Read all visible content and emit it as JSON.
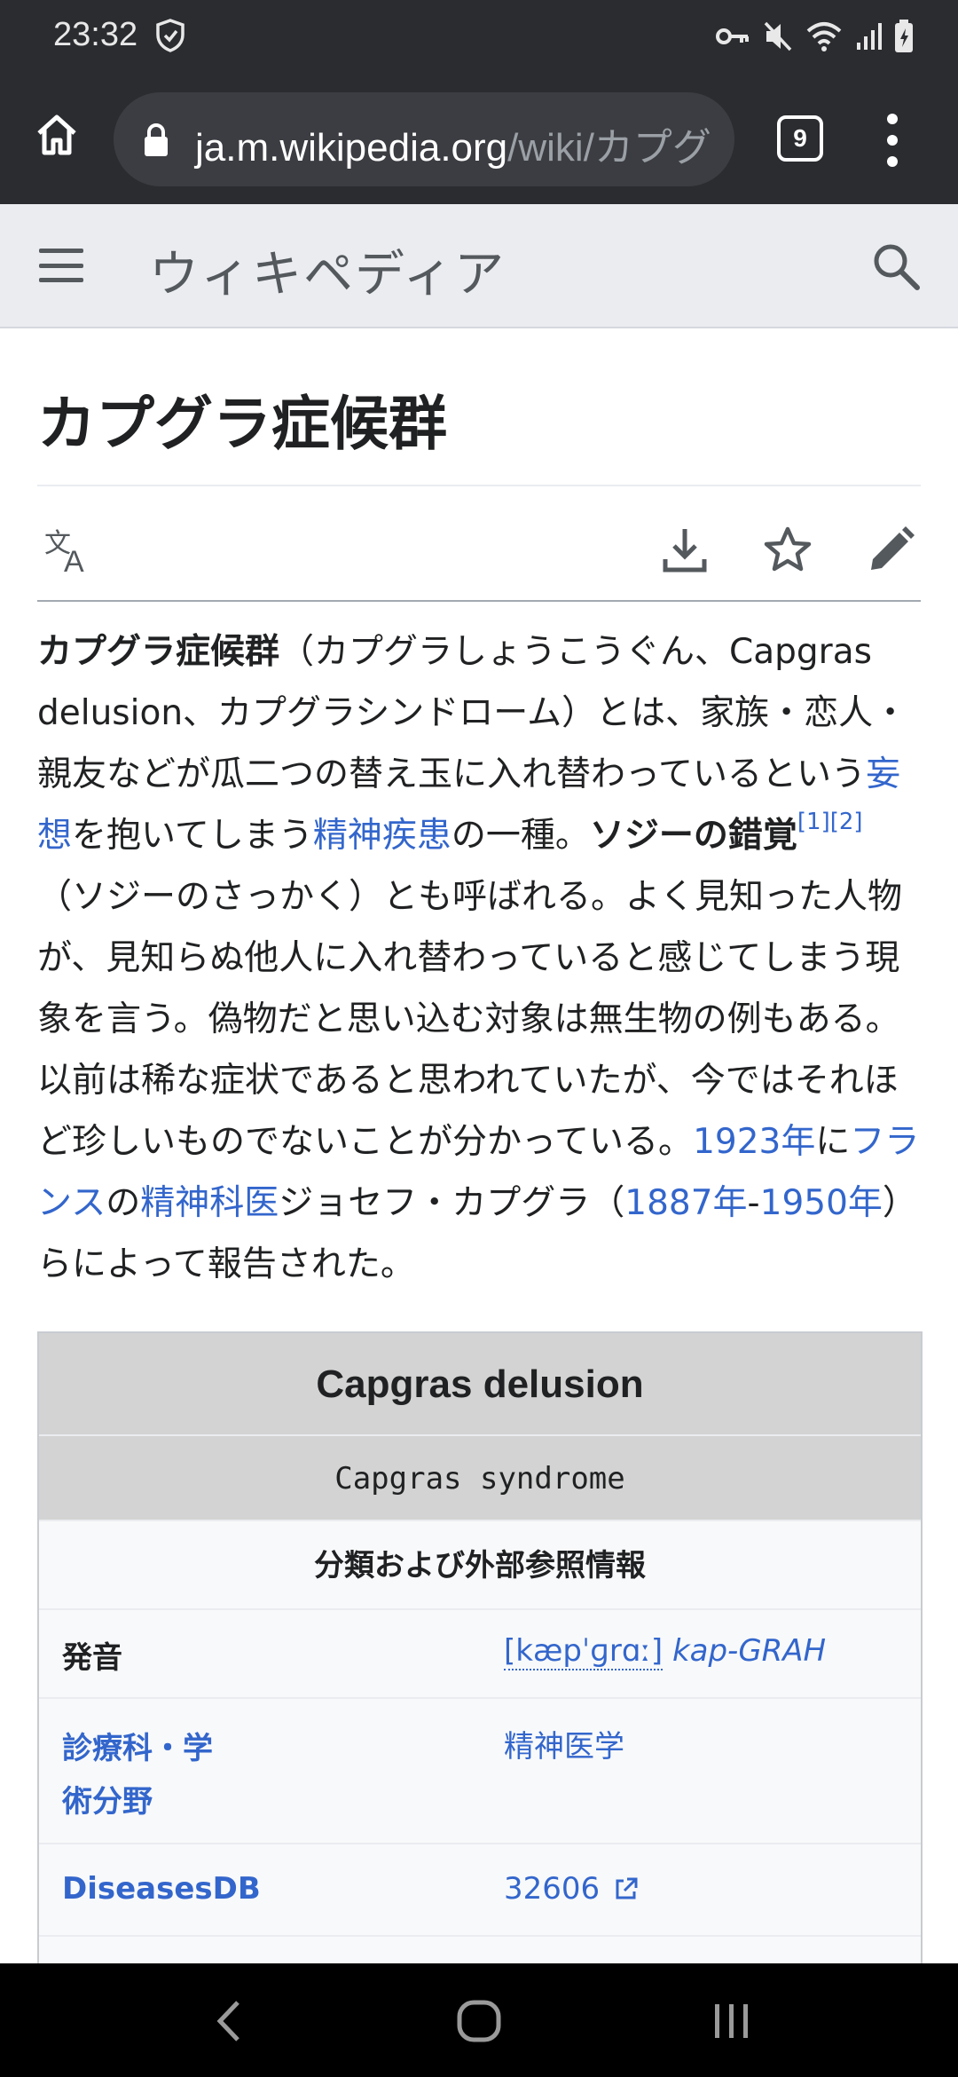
{
  "status_bar": {
    "time": "23:32"
  },
  "browser": {
    "url_domain": "ja.m.wikipedia.org",
    "url_path": "/wiki/カプグ",
    "tab_count": "9"
  },
  "wiki": {
    "logo_text": "ウィキペディア"
  },
  "article": {
    "title": "カプグラ症候群",
    "intro": [
      {
        "t": "b",
        "v": "カプグラ症候群"
      },
      {
        "t": "n",
        "v": "（カプグラしょうこうぐん、Capgras delusion、カプグラシンドローム）とは、家族・恋人・親友などが瓜二つの替え玉に入れ替わっているという"
      },
      {
        "t": "a",
        "v": "妄想"
      },
      {
        "t": "n",
        "v": "を抱いてしまう"
      },
      {
        "t": "a",
        "v": "精神疾患"
      },
      {
        "t": "n",
        "v": "の一種。"
      },
      {
        "t": "b",
        "v": "ソジーの錯覚"
      },
      {
        "t": "s",
        "v": "[1]"
      },
      {
        "t": "s",
        "v": "[2]"
      },
      {
        "t": "n",
        "v": "（ソジーのさっかく）とも呼ばれる。よく見知った人物が、見知らぬ他人に入れ替わっていると感じてしまう現象を言う。偽物だと思い込む対象は無生物の例もある。以前は稀な症状であると思われていたが、今ではそれほど珍しいものでないことが分かっている。"
      },
      {
        "t": "a",
        "v": "1923年"
      },
      {
        "t": "n",
        "v": "に"
      },
      {
        "t": "a",
        "v": "フランス"
      },
      {
        "t": "n",
        "v": "の"
      },
      {
        "t": "a",
        "v": "精神科医"
      },
      {
        "t": "n",
        "v": "ジョセフ・カプグラ（"
      },
      {
        "t": "a",
        "v": "1887年"
      },
      {
        "t": "n",
        "v": "-"
      },
      {
        "t": "a",
        "v": "1950年"
      },
      {
        "t": "n",
        "v": "）らによって報告された。"
      }
    ]
  },
  "infobox": {
    "title": "Capgras delusion",
    "subtitle": "Capgras syndrome",
    "section": "分類および外部参照情報",
    "rows": [
      {
        "label": "発音",
        "value_ipa": "[kæpˈɡrɑː]",
        "value_italic": "kap-GRAH"
      },
      {
        "label": "診療科・学術分野",
        "value": "精神医学"
      },
      {
        "label": "DiseasesDB",
        "value": "32606"
      }
    ]
  },
  "colors": {
    "link": "#3366cc",
    "chrome_bg": "#2b2c30",
    "wiki_header_bg": "#eaecf0"
  }
}
